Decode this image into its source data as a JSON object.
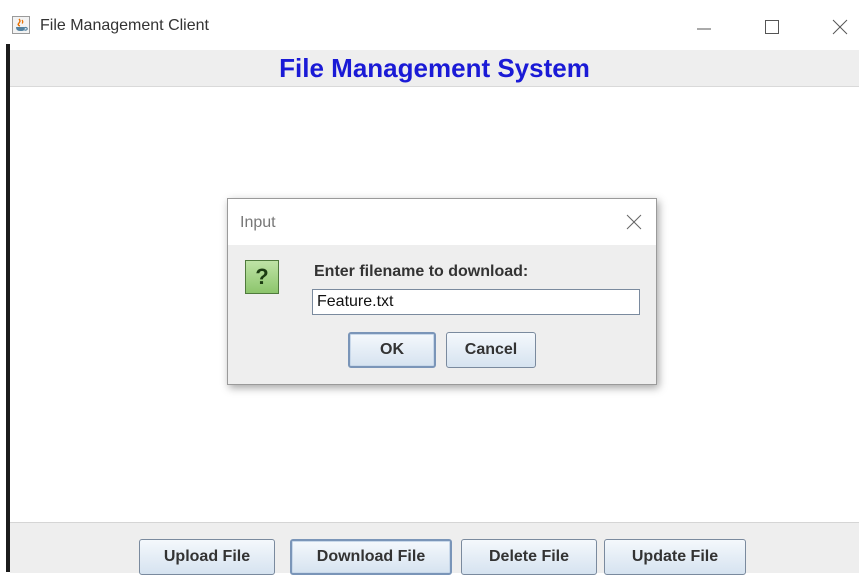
{
  "window": {
    "title": "File Management Client"
  },
  "header": {
    "title": "File Management System"
  },
  "dialog": {
    "title": "Input",
    "prompt": "Enter filename to download:",
    "input_value": "Feature.txt",
    "ok_label": "OK",
    "cancel_label": "Cancel",
    "icon_glyph": "?"
  },
  "bottombar": {
    "buttons": [
      {
        "label": "Upload File"
      },
      {
        "label": "Download File"
      },
      {
        "label": "Delete File"
      },
      {
        "label": "Update File"
      }
    ]
  },
  "colors": {
    "header_title": "#1a1ad6",
    "button_gradient_top": "#f4f8fc",
    "button_gradient_bottom": "#d6e3f0",
    "question_icon": "#8cc56c"
  },
  "icons": {
    "app": "java-coffee-cup-icon",
    "minimize": "minimize-icon",
    "maximize": "maximize-icon",
    "close": "close-icon",
    "dialog_close": "close-icon",
    "question": "question-icon"
  }
}
